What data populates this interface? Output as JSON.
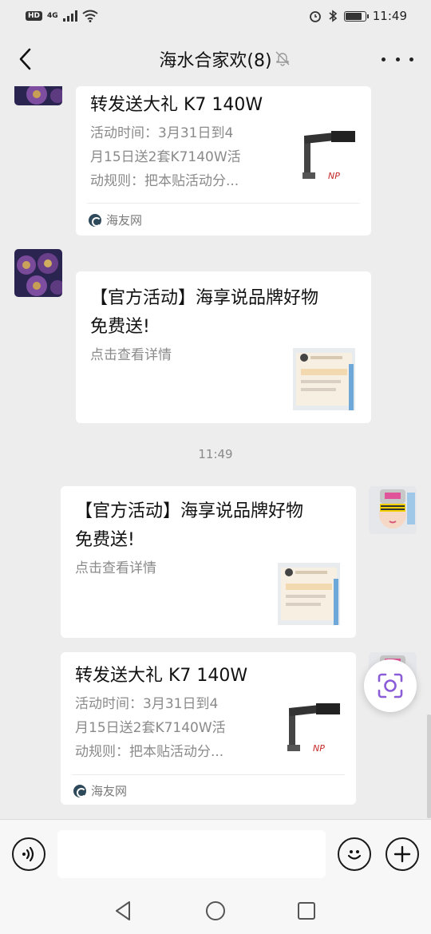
{
  "status_bar": {
    "left_badge": "HD",
    "network": "4G",
    "time": "11:49",
    "battery_level": 0.85
  },
  "nav": {
    "title": "海水合家欢(8)",
    "back_icon": "chevron-left-icon",
    "mute_icon": "bell-muted-icon",
    "more_icon": "more-dots-icon"
  },
  "messages": [
    {
      "side": "left",
      "title": "转发送大礼 K7 140W",
      "desc": "活动时间：3月31日到4月15日送2套K7140W活动规则：把本贴活动分...",
      "desc_lines": [
        "活动时间：3月31日到4",
        "月15日送2套K7140W活",
        "动规则：把本贴活动分..."
      ],
      "source": "海友网"
    },
    {
      "side": "left",
      "title_lines": [
        "【官方活动】海享说品牌好物",
        "免费送!"
      ],
      "desc": "点击查看详情"
    },
    {
      "timestamp": "11:49"
    },
    {
      "side": "right",
      "title_lines": [
        "【官方活动】海享说品牌好物",
        "免费送!"
      ],
      "desc": "点击查看详情"
    },
    {
      "side": "right",
      "title": "转发送大礼 K7 140W",
      "desc_lines": [
        "活动时间：3月31日到4",
        "月15日送2套K7140W活",
        "动规则：把本贴活动分..."
      ],
      "source": "海友网"
    }
  ],
  "input_bar": {
    "voice_icon": "voice-icon",
    "emoji_icon": "emoji-icon",
    "plus_icon": "plus-icon",
    "input_value": ""
  },
  "system_nav": {
    "back_icon": "triangle-back-icon",
    "home_icon": "circle-home-icon",
    "recents_icon": "square-recents-icon"
  },
  "colors": {
    "background": "#ededed",
    "bubble": "#ffffff",
    "accent_float": "#8a5cd8"
  }
}
